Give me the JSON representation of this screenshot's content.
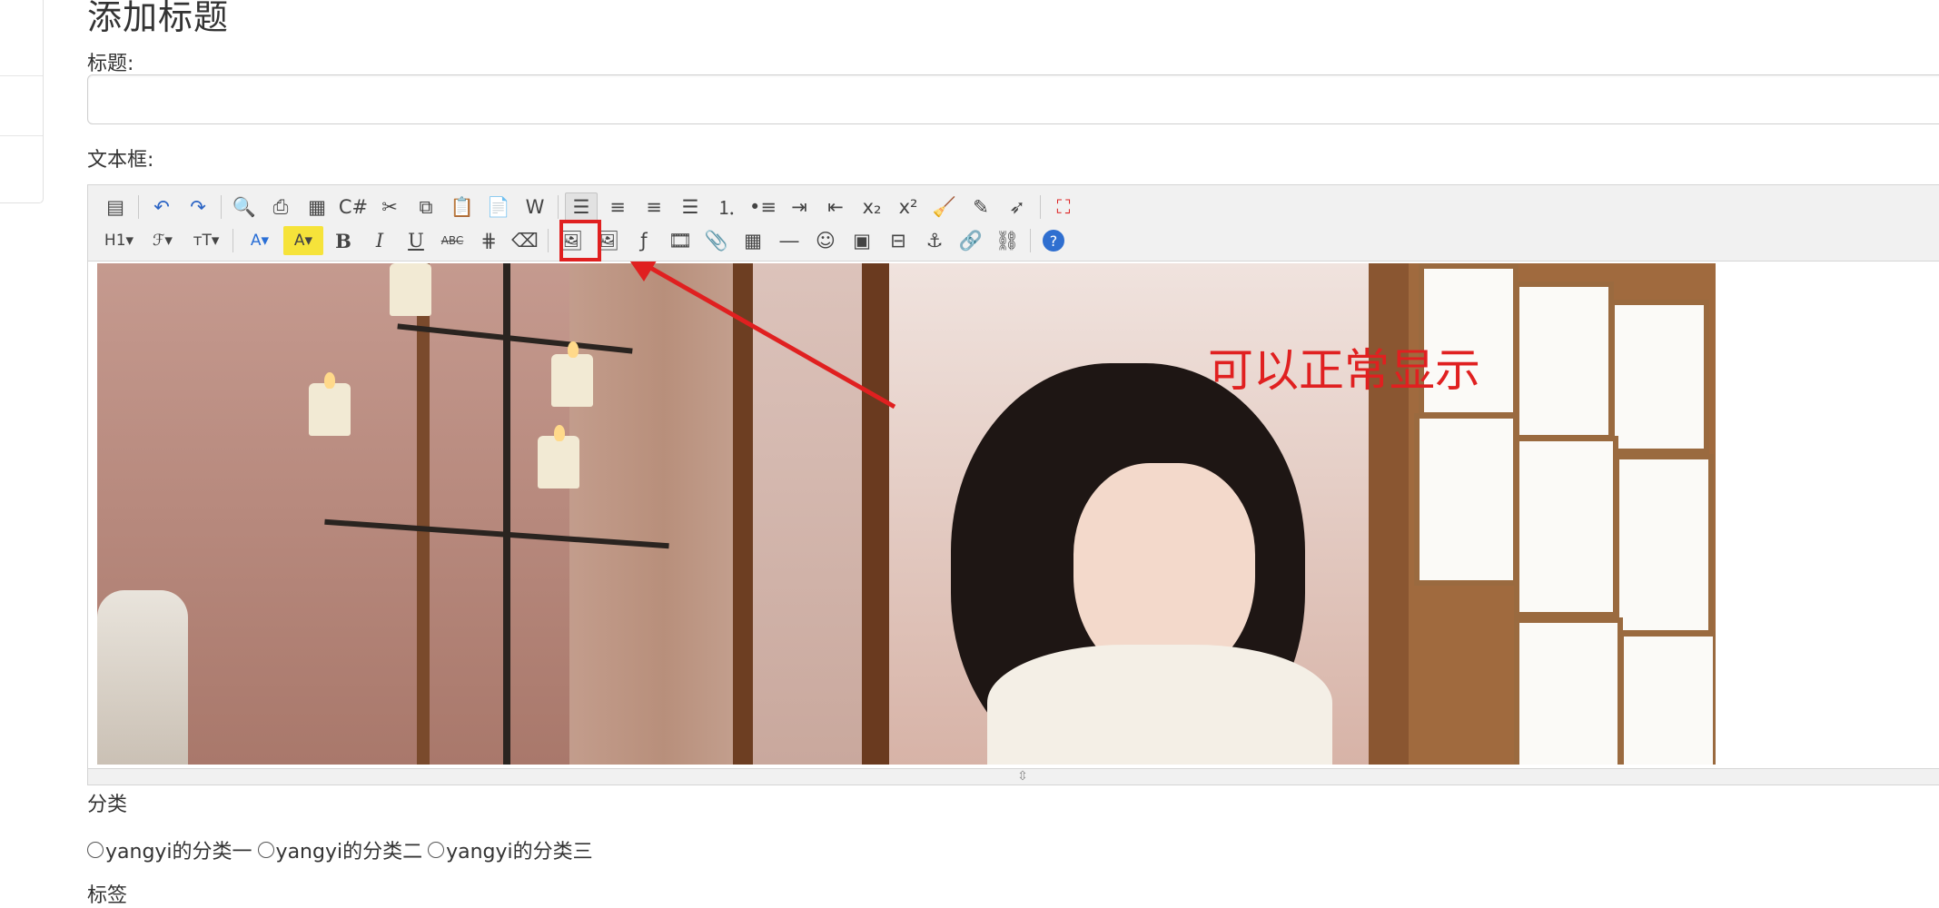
{
  "page": {
    "title": "添加标题"
  },
  "form": {
    "title_label": "标题:",
    "title_value": "",
    "content_label": "文本框:",
    "category_label": "分类",
    "categories": [
      "yangyi的分类一",
      "yangyi的分类二",
      "yangyi的分类三"
    ],
    "tags_label": "标签"
  },
  "toolbar": {
    "row1": [
      {
        "icon": "source-icon",
        "glyph": "▤"
      },
      {
        "sep": true
      },
      {
        "icon": "undo-icon",
        "glyph": "↶"
      },
      {
        "icon": "redo-icon",
        "glyph": "↷"
      },
      {
        "sep": true
      },
      {
        "icon": "preview-icon",
        "glyph": "🔍"
      },
      {
        "icon": "print-icon",
        "glyph": "⎙"
      },
      {
        "icon": "template-icon",
        "glyph": "▦"
      },
      {
        "icon": "code-icon",
        "glyph": "C#"
      },
      {
        "icon": "cut-icon",
        "glyph": "✂"
      },
      {
        "icon": "copy-icon",
        "glyph": "⧉"
      },
      {
        "icon": "paste-icon",
        "glyph": "📋"
      },
      {
        "icon": "paste-text-icon",
        "glyph": "📄"
      },
      {
        "icon": "paste-word-icon",
        "glyph": "W"
      },
      {
        "sep": true
      },
      {
        "icon": "align-left-icon",
        "glyph": "☰",
        "active": true
      },
      {
        "icon": "align-center-icon",
        "glyph": "≡"
      },
      {
        "icon": "align-right-icon",
        "glyph": "≡"
      },
      {
        "icon": "align-justify-icon",
        "glyph": "☰"
      },
      {
        "icon": "ordered-list-icon",
        "glyph": "⒈"
      },
      {
        "icon": "unordered-list-icon",
        "glyph": "•≡"
      },
      {
        "icon": "indent-icon",
        "glyph": "⇥"
      },
      {
        "icon": "outdent-icon",
        "glyph": "⇤"
      },
      {
        "icon": "subscript-icon",
        "glyph": "x₂"
      },
      {
        "icon": "superscript-icon",
        "glyph": "x²"
      },
      {
        "icon": "clear-format-icon",
        "glyph": "🧹"
      },
      {
        "icon": "quick-format-icon",
        "glyph": "✎"
      },
      {
        "icon": "select-all-icon",
        "glyph": "➶"
      },
      {
        "sep": true
      },
      {
        "icon": "fullscreen-icon",
        "glyph": "⛶"
      }
    ],
    "row2": [
      {
        "icon": "heading-icon",
        "glyph": "H1▾",
        "wide": true
      },
      {
        "icon": "font-family-icon",
        "glyph": "ℱ▾",
        "wide": true
      },
      {
        "icon": "font-size-icon",
        "glyph": "ᴛT▾",
        "wide": true
      },
      {
        "sep": true
      },
      {
        "icon": "font-color-icon",
        "glyph": "A▾",
        "wide": true
      },
      {
        "icon": "highlight-color-icon",
        "glyph": "A▾",
        "wide": true
      },
      {
        "icon": "bold-icon",
        "glyph": "B"
      },
      {
        "icon": "italic-icon",
        "glyph": "I"
      },
      {
        "icon": "underline-icon",
        "glyph": "U"
      },
      {
        "icon": "strikethrough-icon",
        "glyph": "ABC"
      },
      {
        "icon": "line-height-icon",
        "glyph": "⋕"
      },
      {
        "icon": "eraser-icon",
        "glyph": "⌫"
      },
      {
        "sep": true
      },
      {
        "icon": "insert-image-icon",
        "glyph": "🖼"
      },
      {
        "icon": "multi-image-icon",
        "glyph": "🖼"
      },
      {
        "icon": "flash-icon",
        "glyph": "ƒ"
      },
      {
        "icon": "media-icon",
        "glyph": "🎞"
      },
      {
        "icon": "attachment-icon",
        "glyph": "📎"
      },
      {
        "icon": "table-icon",
        "glyph": "▦"
      },
      {
        "icon": "hr-icon",
        "glyph": "―"
      },
      {
        "icon": "emoticon-icon",
        "glyph": "☺"
      },
      {
        "icon": "baidu-map-icon",
        "glyph": "▣"
      },
      {
        "icon": "page-break-icon",
        "glyph": "⊟"
      },
      {
        "icon": "anchor-icon",
        "glyph": "⚓"
      },
      {
        "icon": "link-icon",
        "glyph": "🔗"
      },
      {
        "icon": "unlink-icon",
        "glyph": "⛓"
      },
      {
        "sep": true
      },
      {
        "icon": "help-icon",
        "glyph": "?"
      }
    ]
  },
  "content": {
    "annotation_text": "可以正常显示"
  },
  "colors": {
    "annotation_red": "#e02020",
    "toolbar_bg": "#f1f1f1"
  }
}
